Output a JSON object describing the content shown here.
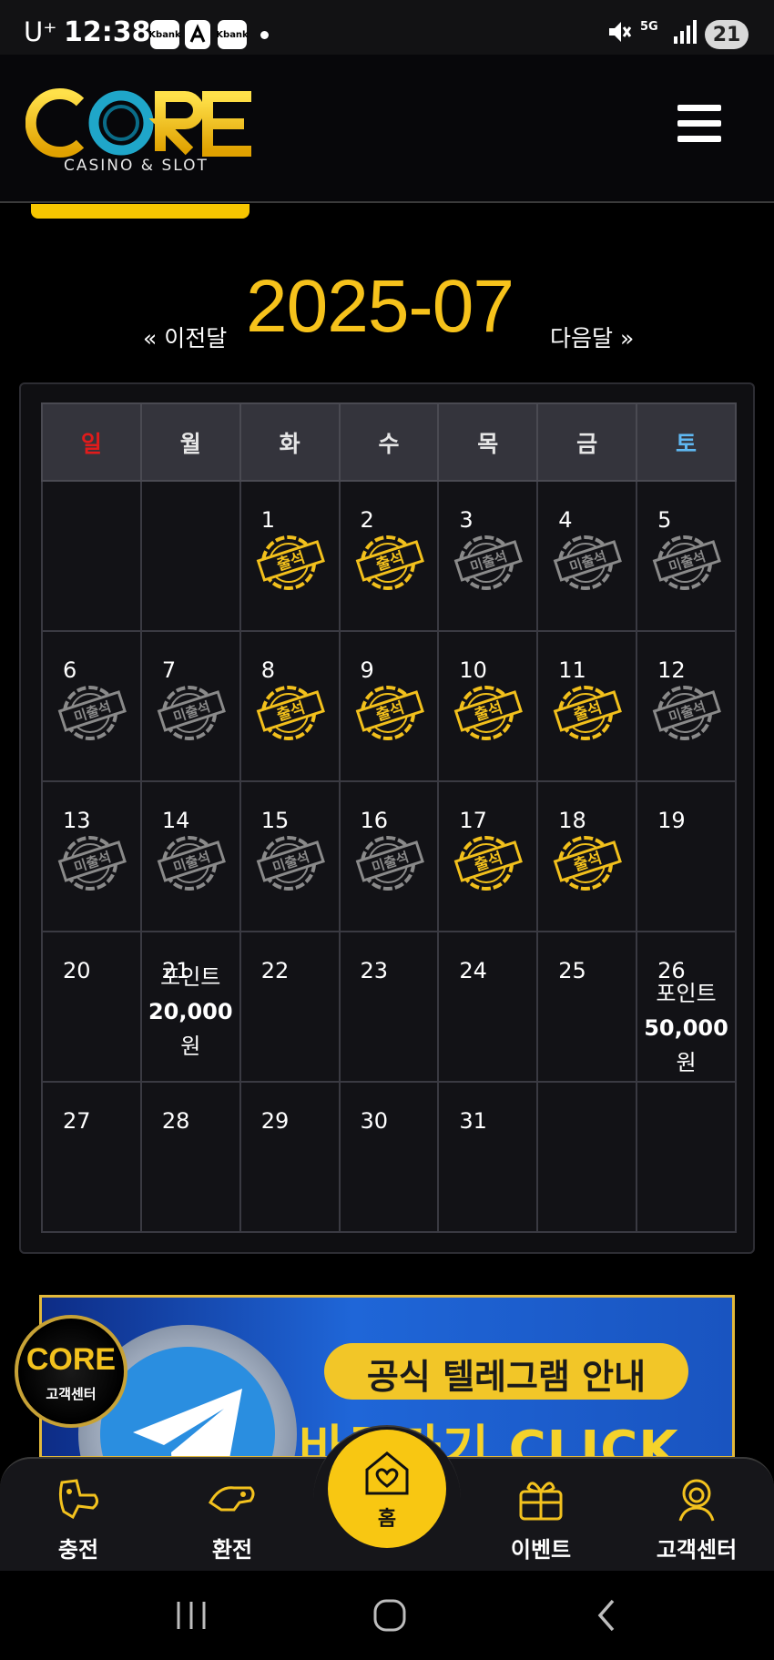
{
  "status_bar": {
    "carrier": "U⁺",
    "time": "12:38",
    "notifications": [
      "Kbank",
      "",
      "Kbank"
    ],
    "network": "5G",
    "battery": "21"
  },
  "header": {
    "logo_text": "CORE",
    "logo_subtitle": "CASINO & SLOT"
  },
  "month_nav": {
    "prev_label": "« 이전달",
    "title": "2025-07",
    "next_label": "다음달 »"
  },
  "calendar": {
    "weekdays": [
      "일",
      "월",
      "화",
      "수",
      "목",
      "금",
      "토"
    ],
    "colors": {
      "sunday": "#e11b1b",
      "saturday": "#5fb8f2",
      "attended": "#f2c01c",
      "absent": "#8a8a8a"
    },
    "stamp_labels": {
      "attended": "출석",
      "absent": "미출석"
    },
    "weeks": [
      [
        {
          "day": ""
        },
        {
          "day": ""
        },
        {
          "day": "1",
          "stamp": "attended"
        },
        {
          "day": "2",
          "stamp": "attended"
        },
        {
          "day": "3",
          "stamp": "absent"
        },
        {
          "day": "4",
          "stamp": "absent"
        },
        {
          "day": "5",
          "stamp": "absent"
        }
      ],
      [
        {
          "day": "6",
          "stamp": "absent"
        },
        {
          "day": "7",
          "stamp": "absent"
        },
        {
          "day": "8",
          "stamp": "attended"
        },
        {
          "day": "9",
          "stamp": "attended"
        },
        {
          "day": "10",
          "stamp": "attended"
        },
        {
          "day": "11",
          "stamp": "attended"
        },
        {
          "day": "12",
          "stamp": "absent"
        }
      ],
      [
        {
          "day": "13",
          "stamp": "absent"
        },
        {
          "day": "14",
          "stamp": "absent"
        },
        {
          "day": "15",
          "stamp": "absent"
        },
        {
          "day": "16",
          "stamp": "absent"
        },
        {
          "day": "17",
          "stamp": "attended"
        },
        {
          "day": "18",
          "stamp": "attended"
        },
        {
          "day": "19"
        }
      ],
      [
        {
          "day": "20"
        },
        {
          "day": "21",
          "reward": {
            "label": "포인트",
            "amount": "20,000",
            "unit": "원"
          }
        },
        {
          "day": "22"
        },
        {
          "day": "23"
        },
        {
          "day": "24"
        },
        {
          "day": "25"
        },
        {
          "day": "26",
          "reward": {
            "label": "포인트",
            "amount": "50,000",
            "unit": "원"
          }
        }
      ],
      [
        {
          "day": "27"
        },
        {
          "day": "28"
        },
        {
          "day": "29"
        },
        {
          "day": "30"
        },
        {
          "day": "31"
        },
        {
          "day": ""
        },
        {
          "day": ""
        }
      ]
    ]
  },
  "banner": {
    "title": "공식 텔레그램 안내",
    "subtitle": "바로가기 CLICK"
  },
  "support_badge": {
    "logo_text": "CORE",
    "label": "고객센터"
  },
  "bottom_nav": {
    "items": [
      {
        "label": "충전",
        "icon": "deposit-icon"
      },
      {
        "label": "환전",
        "icon": "withdraw-icon"
      },
      {
        "label": "홈",
        "icon": "home-heart-icon"
      },
      {
        "label": "이벤트",
        "icon": "gift-icon"
      },
      {
        "label": "고객센터",
        "icon": "support-agent-icon"
      }
    ]
  },
  "android_nav": [
    "recent-apps-icon",
    "home-icon",
    "back-icon"
  ]
}
